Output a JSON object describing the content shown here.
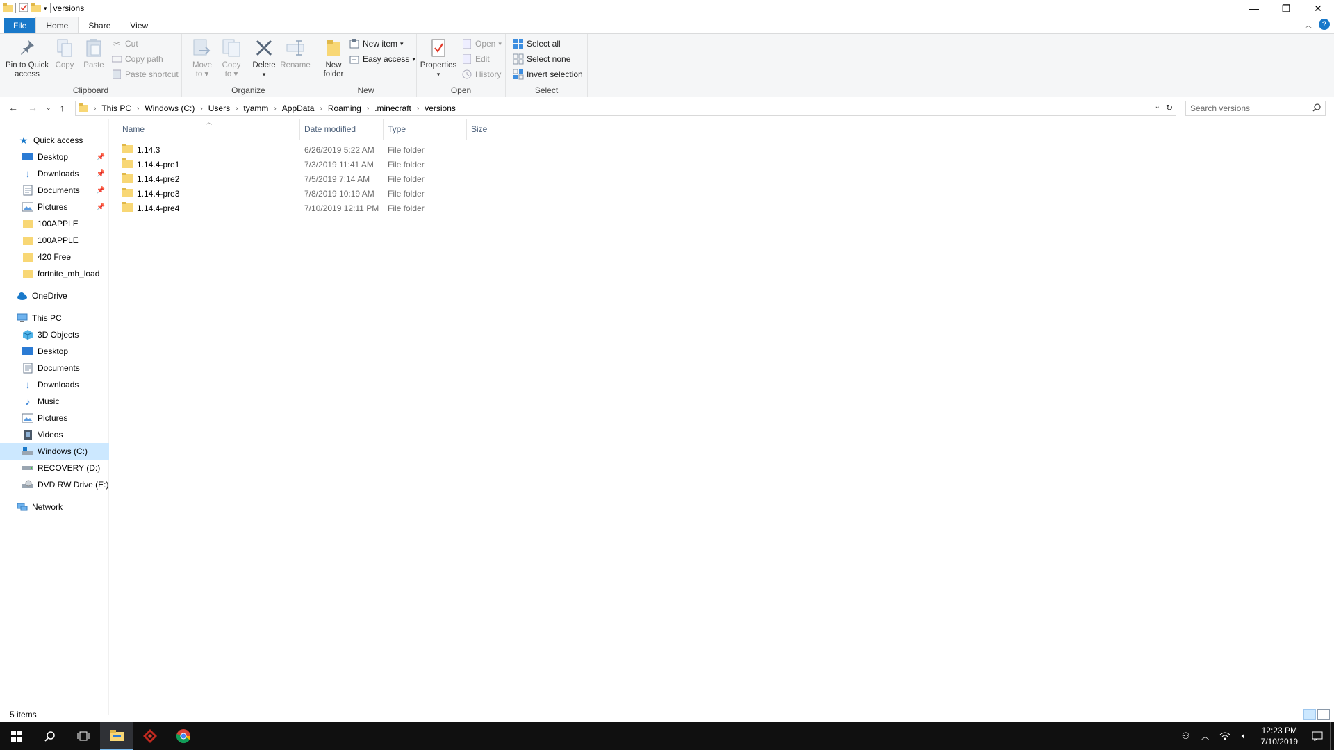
{
  "window": {
    "title": "versions",
    "controls": {
      "minimize": "—",
      "restore": "❐",
      "close": "✕"
    }
  },
  "ribbon_tabs": [
    {
      "label": "File"
    },
    {
      "label": "Home"
    },
    {
      "label": "Share"
    },
    {
      "label": "View"
    }
  ],
  "ribbon": {
    "clipboard": {
      "label": "Clipboard",
      "pin": "Pin to Quick",
      "pin2": "access",
      "copy": "Copy",
      "paste": "Paste",
      "cut": "Cut",
      "copy_path": "Copy path",
      "paste_shortcut": "Paste shortcut"
    },
    "organize": {
      "label": "Organize",
      "move_to": "Move",
      "move_to2": "to",
      "copy_to": "Copy",
      "copy_to2": "to",
      "delete": "Delete",
      "rename": "Rename"
    },
    "new": {
      "label": "New",
      "new_folder": "New",
      "new_folder2": "folder",
      "new_item": "New item",
      "easy_access": "Easy access"
    },
    "open": {
      "label": "Open",
      "properties": "Properties",
      "open": "Open",
      "edit": "Edit",
      "history": "History"
    },
    "select": {
      "label": "Select",
      "select_all": "Select all",
      "select_none": "Select none",
      "invert": "Invert selection"
    }
  },
  "address": {
    "crumbs": [
      "This PC",
      "Windows (C:)",
      "Users",
      "tyamm",
      "AppData",
      "Roaming",
      ".minecraft",
      "versions"
    ],
    "search_placeholder": "Search versions"
  },
  "sidebar": {
    "quick_access": "Quick access",
    "quick_items": [
      "Desktop",
      "Downloads",
      "Documents",
      "Pictures"
    ],
    "recent_folders": [
      "100APPLE",
      "100APPLE",
      "420 Free",
      "fortnite_mh_load"
    ],
    "onedrive": "OneDrive",
    "this_pc": "This PC",
    "pc_items": [
      "3D Objects",
      "Desktop",
      "Documents",
      "Downloads",
      "Music",
      "Pictures",
      "Videos",
      "Windows (C:)",
      "RECOVERY (D:)",
      "DVD RW Drive (E:) D"
    ],
    "network": "Network"
  },
  "columns": {
    "name": "Name",
    "date": "Date modified",
    "type": "Type",
    "size": "Size"
  },
  "files": [
    {
      "name": "1.14.3",
      "date": "6/26/2019 5:22 AM",
      "type": "File folder"
    },
    {
      "name": "1.14.4-pre1",
      "date": "7/3/2019 11:41 AM",
      "type": "File folder"
    },
    {
      "name": "1.14.4-pre2",
      "date": "7/5/2019 7:14 AM",
      "type": "File folder"
    },
    {
      "name": "1.14.4-pre3",
      "date": "7/8/2019 10:19 AM",
      "type": "File folder"
    },
    {
      "name": "1.14.4-pre4",
      "date": "7/10/2019 12:11 PM",
      "type": "File folder"
    }
  ],
  "status": {
    "items": "5 items"
  },
  "taskbar": {
    "time": "12:23 PM",
    "date": "7/10/2019"
  },
  "colors": {
    "accent": "#1979ca",
    "folder": "#f8d775",
    "selection": "#cce8ff",
    "taskbar": "#101010"
  }
}
